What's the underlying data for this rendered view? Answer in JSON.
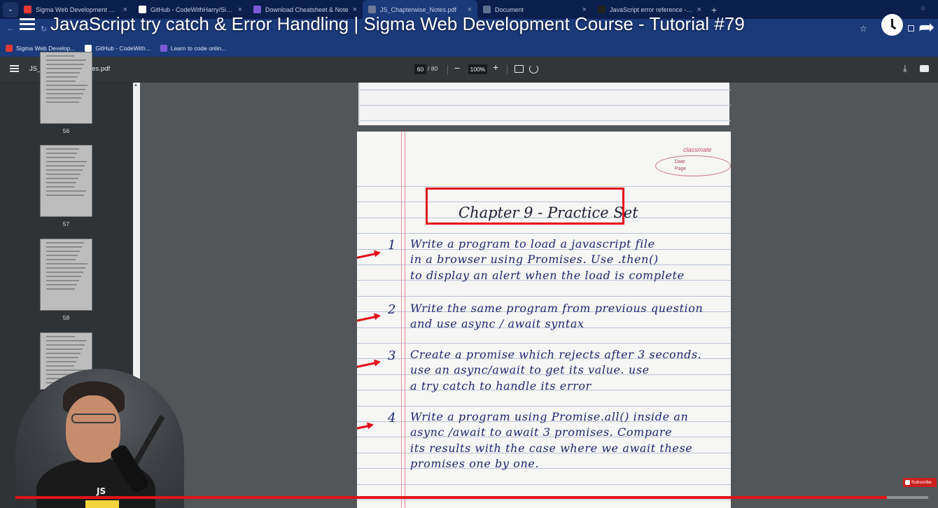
{
  "browser": {
    "tabs": [
      {
        "title": "Sigma Web Development Cour",
        "color": "#e53935",
        "active": false
      },
      {
        "title": "GitHub - CodeWithHarry/Sigm",
        "color": "#ffffff",
        "active": false
      },
      {
        "title": "Download Cheatsheet & Note",
        "color": "#7b5cd6",
        "active": false
      },
      {
        "title": "JS_Chapterwise_Notes.pdf",
        "color": "#6c7a96",
        "active": true
      },
      {
        "title": "Document",
        "color": "#5f6f8f",
        "active": false
      },
      {
        "title": "JavaScript error reference - Jav",
        "color": "#222222",
        "active": false
      }
    ],
    "bookmarks": [
      {
        "label": "Sigma Web Develop...",
        "color": "#e53935"
      },
      {
        "label": "GitHub - CodeWith...",
        "color": "#ffffff"
      },
      {
        "label": "Learn to code onlin...",
        "color": "#7b5cd6"
      }
    ]
  },
  "video": {
    "title": "JavaScript try catch & Error Handling | Sigma Web Development Course - Tutorial #79",
    "progress": 0.955,
    "subscribe_label": "Subscribe",
    "shirt_text": "JS"
  },
  "pdf": {
    "filename": "JS_Chapterwise_Notes.pdf",
    "current_page": "60",
    "total_pages": "/ 80",
    "zoom": "100%",
    "thumbnails": [
      {
        "page": "56"
      },
      {
        "page": "57"
      },
      {
        "page": "58"
      },
      {
        "page": ""
      }
    ],
    "notebook": {
      "brand": "classmate",
      "date_label": "Date",
      "page_label": "Page"
    },
    "chapter_title": "Chapter 9 - Practice Set",
    "questions": [
      {
        "num": "1",
        "lines": [
          "Write a program to load a javascript file",
          "in a browser using Promises. Use .then()",
          "to display an alert when the load is complete"
        ]
      },
      {
        "num": "2",
        "lines": [
          "Write the same program from previous question",
          "and use async / await syntax"
        ]
      },
      {
        "num": "3",
        "lines": [
          "Create a promise which rejects after 3 seconds.",
          "use an async/await to get its value. use",
          "a try catch to handle its error"
        ]
      },
      {
        "num": "4",
        "lines": [
          "Write a program using Promise.all() inside an",
          "async /await to await 3 promises. Compare",
          "its results with the case where we await these",
          "promises one by one."
        ]
      }
    ]
  },
  "colors": {
    "highlight_red": "#e10e1a",
    "ink_blue": "#1c2570",
    "chrome_blue": "#1a3a7a"
  }
}
